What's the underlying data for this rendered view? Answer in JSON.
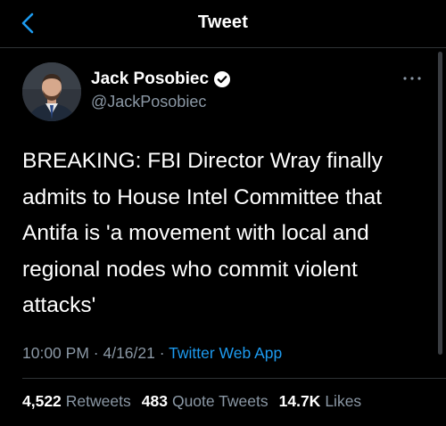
{
  "header": {
    "title": "Tweet",
    "back_icon": "chevron-left-icon",
    "accent": "#1d9bf0"
  },
  "author": {
    "name": "Jack Posobiec",
    "handle": "@JackPosobiec",
    "verified_icon": "verified-badge-icon",
    "more_icon": "more-icon"
  },
  "tweet": {
    "text": "BREAKING: FBI Director Wray finally\nadmits to House Intel Committee that\nAntifa is 'a movement with local and\nregional nodes who commit violent\nattacks'"
  },
  "meta": {
    "time": "10:00 PM",
    "separator": "·",
    "date": "4/16/21",
    "source": "Twitter Web App"
  },
  "stats": {
    "retweets_count": "4,522",
    "retweets_label": "Retweets",
    "quotes_count": "483",
    "quotes_label": "Quote Tweets",
    "likes_count": "14.7K",
    "likes_label": "Likes"
  }
}
